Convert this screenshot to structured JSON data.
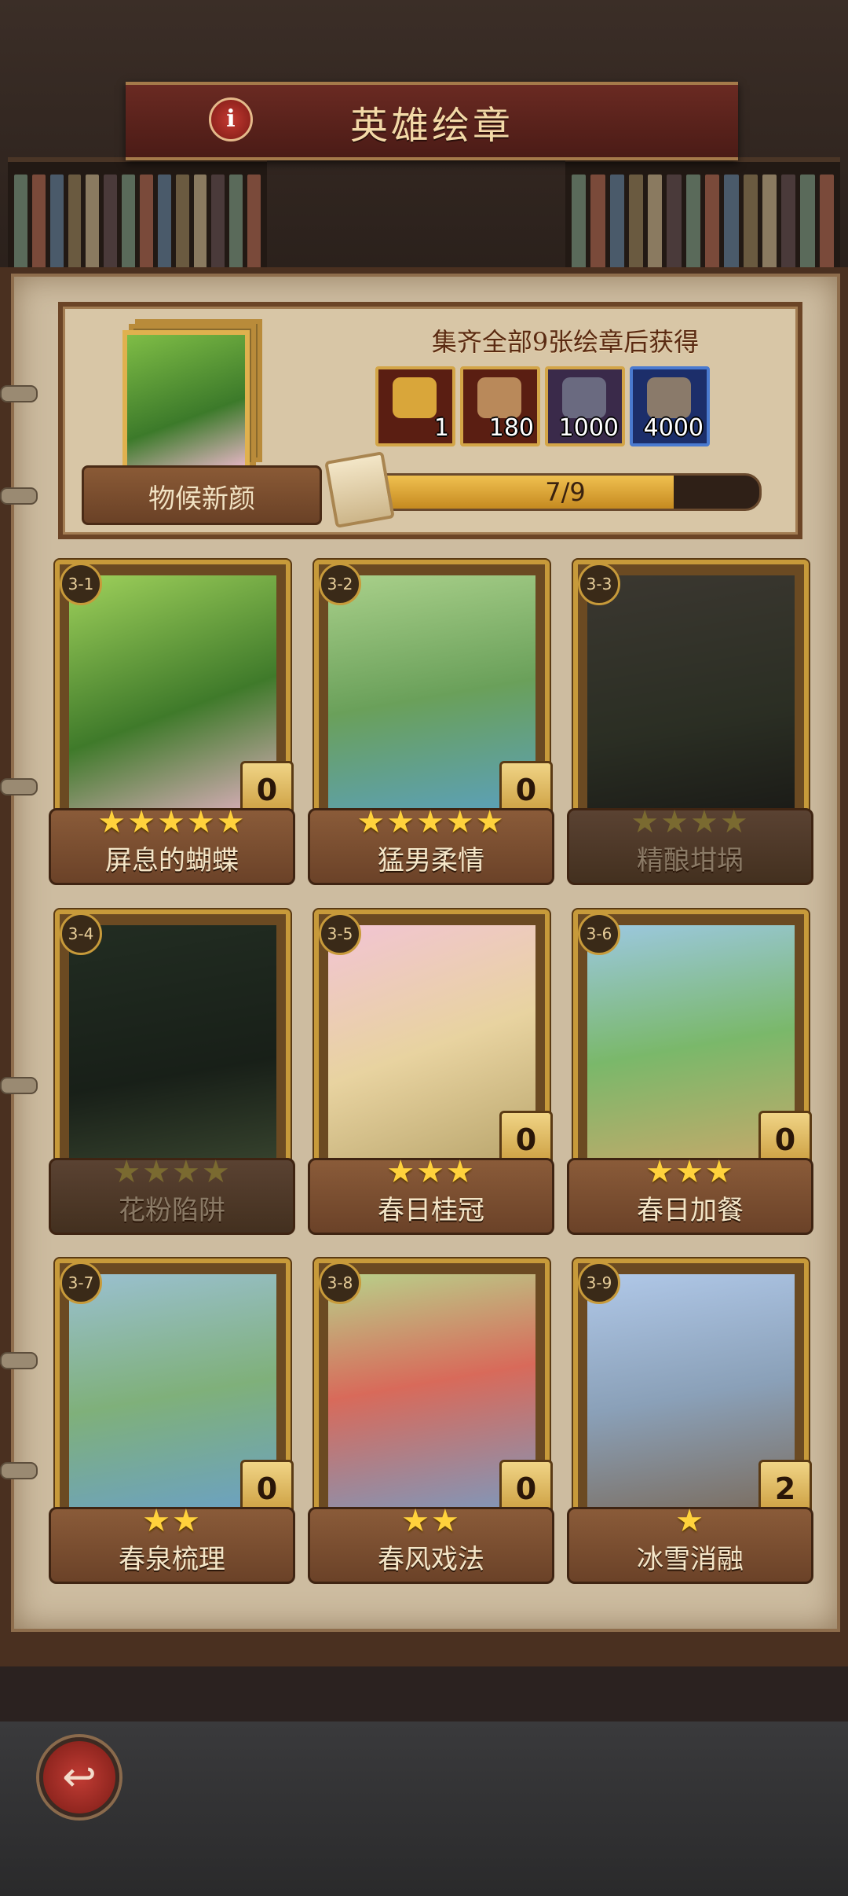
{
  "header": {
    "title": "英雄绘章",
    "info_icon": "info-icon"
  },
  "reward_panel": {
    "cover_name": "物候新颜",
    "header": "集齐全部9张绘章后获得",
    "rewards": [
      {
        "icon": "coin-bag-icon",
        "count": "1",
        "color": "#d9a63a"
      },
      {
        "icon": "scroll-icon",
        "count": "180",
        "color": "#b9895a"
      },
      {
        "icon": "ore-icon",
        "count": "1000",
        "color": "#6a6a80"
      },
      {
        "icon": "rock-icon",
        "count": "4000",
        "color": "#8a7a6a"
      }
    ],
    "progress_text": "7/9",
    "progress": 0.78
  },
  "cards": [
    {
      "id": "3-1",
      "name": "屏息的蝴蝶",
      "stars": "★★★★★",
      "count": "0",
      "locked": false,
      "art": "linear-gradient(160deg,#9fd15b,#3f7a2a 55%,#e9b3c8)"
    },
    {
      "id": "3-2",
      "name": "猛男柔情",
      "stars": "★★★★★",
      "count": "0",
      "locked": false,
      "art": "linear-gradient(170deg,#a9d08a,#6aa05a 50%,#5aa0c0)"
    },
    {
      "id": "3-3",
      "name": "精酿坩埚",
      "stars": "★★★★",
      "count": "",
      "locked": true,
      "art": "linear-gradient(170deg,#8a7a5a,#5a6a3a 60%,#3a3a2a)"
    },
    {
      "id": "3-4",
      "name": "花粉陷阱",
      "stars": "★★★★",
      "count": "",
      "locked": true,
      "art": "linear-gradient(170deg,#3a6a3a,#2a4a2a 60%,#6aa040)"
    },
    {
      "id": "3-5",
      "name": "春日桂冠",
      "stars": "★★★",
      "count": "0",
      "locked": false,
      "art": "linear-gradient(160deg,#f2c4d4,#e8d3a0 50%,#b7a36a)"
    },
    {
      "id": "3-6",
      "name": "春日加餐",
      "stars": "★★★",
      "count": "0",
      "locked": false,
      "art": "linear-gradient(170deg,#9cc8e0,#7ab86a 50%,#c9a86a)"
    },
    {
      "id": "3-7",
      "name": "春泉梳理",
      "stars": "★★",
      "count": "0",
      "locked": false,
      "art": "linear-gradient(170deg,#9ac0d0,#7fb07a 50%,#6aa0c8)"
    },
    {
      "id": "3-8",
      "name": "春风戏法",
      "stars": "★★",
      "count": "0",
      "locked": false,
      "art": "linear-gradient(170deg,#b8d08a,#d86a5a 45%,#7a9ac0)"
    },
    {
      "id": "3-9",
      "name": "冰雪消融",
      "stars": "★",
      "count": "2",
      "locked": false,
      "art": "linear-gradient(170deg,#b0c8e8,#8aa0b8 50%,#7a6a5a)"
    }
  ],
  "footer": {
    "back_icon": "back-arrow-icon",
    "back_glyph": "↩"
  }
}
